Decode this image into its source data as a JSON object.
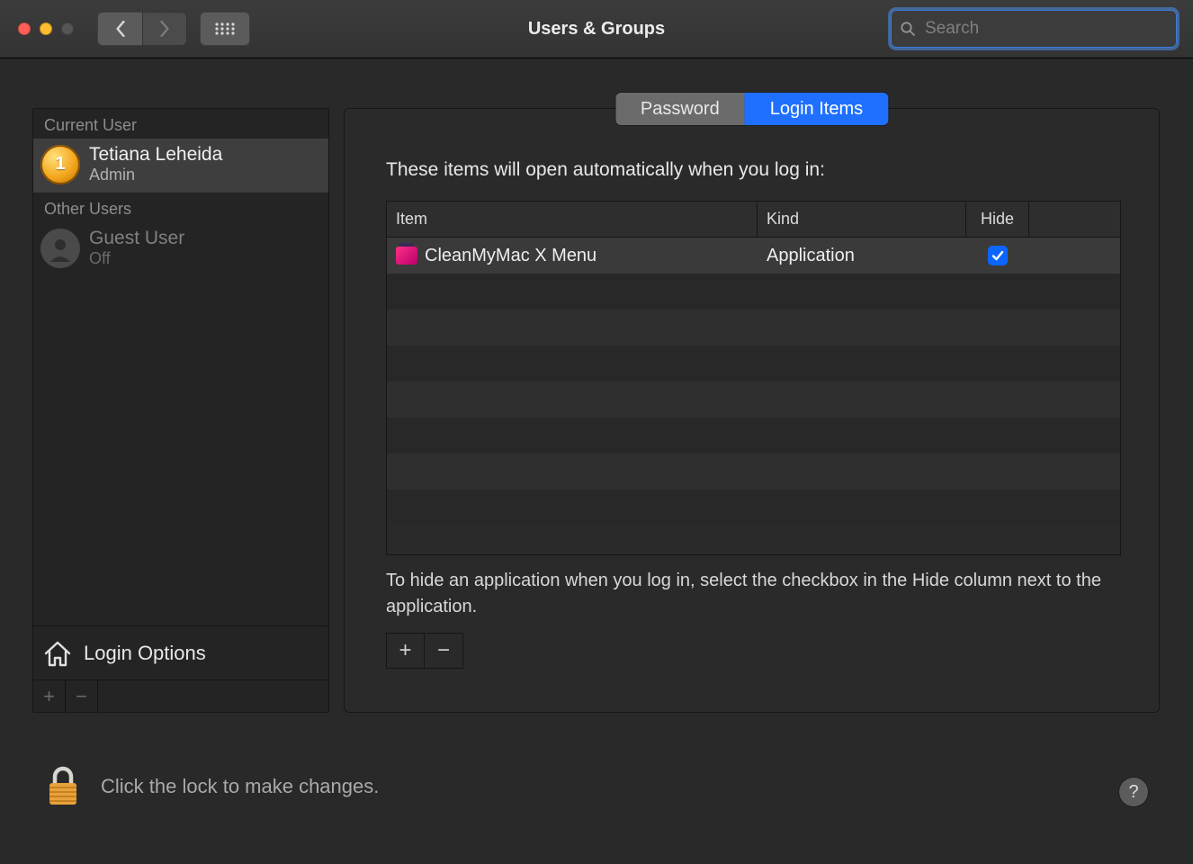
{
  "window": {
    "title": "Users & Groups",
    "search_placeholder": "Search"
  },
  "sidebar": {
    "current_label": "Current User",
    "other_label": "Other Users",
    "current_user": {
      "name": "Tetiana Leheida",
      "role": "Admin"
    },
    "other_users": [
      {
        "name": "Guest User",
        "role": "Off"
      }
    ],
    "login_options_label": "Login Options"
  },
  "main": {
    "tabs": {
      "password": "Password",
      "login_items": "Login Items"
    },
    "intro": "These items will open automatically when you log in:",
    "columns": {
      "item": "Item",
      "kind": "Kind",
      "hide": "Hide"
    },
    "rows": [
      {
        "item": "CleanMyMac X Menu",
        "kind": "Application",
        "hide": true
      }
    ],
    "hint": "To hide an application when you log in, select the checkbox in the Hide column next to the application."
  },
  "footer": {
    "lock_text": "Click the lock to make changes.",
    "help": "?"
  },
  "glyphs": {
    "plus": "+",
    "minus": "−",
    "medal": "1"
  }
}
